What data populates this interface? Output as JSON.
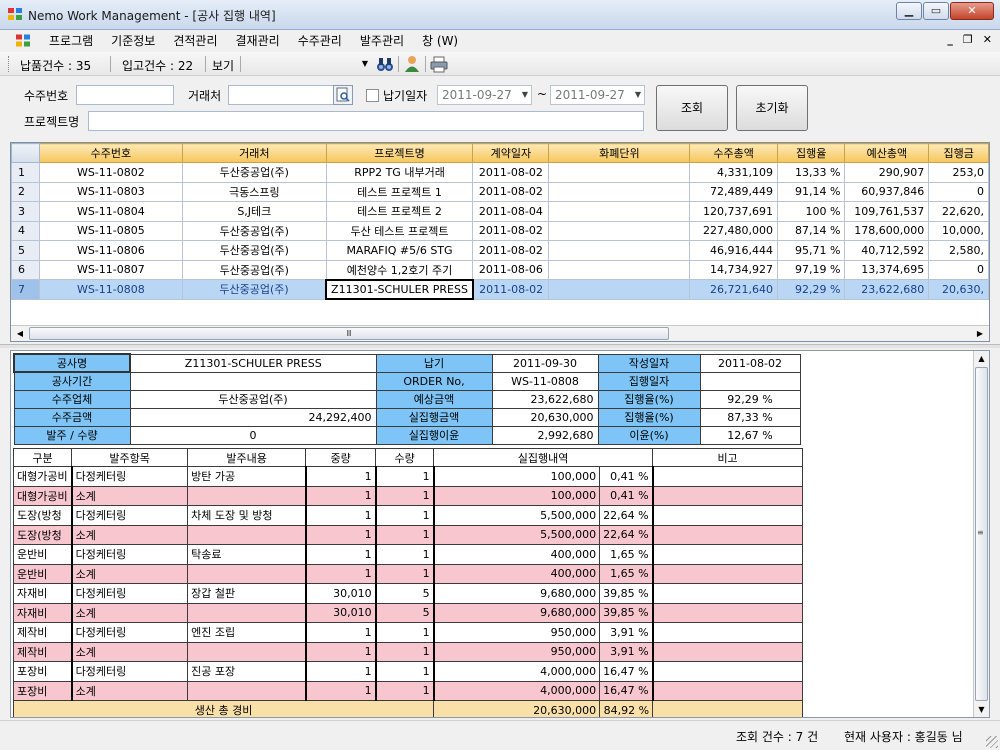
{
  "window": {
    "title": "Nemo Work Management - [공사 집행 내역]"
  },
  "menu": [
    "프로그램",
    "기준정보",
    "견적관리",
    "결재관리",
    "수주관리",
    "발주관리",
    "창 (W)"
  ],
  "toolbar": {
    "delivery": "납품건수 : 35",
    "receipt": "입고건수 : 22",
    "view": "보기"
  },
  "search": {
    "order_no_label": "수주번호",
    "client_label": "거래처",
    "due_label": "납기일자",
    "date_from": "2011-09-27",
    "tilde": "~",
    "date_to": "2011-09-27",
    "project_label": "프로젝트명",
    "search_button": "조회",
    "reset_button": "초기화"
  },
  "grid": {
    "columns": [
      "",
      "수주번호",
      "거래처",
      "프로젝트명",
      "계약일자",
      "화폐단위",
      "수주총액",
      "집행율",
      "예산총액",
      "집행금"
    ],
    "rows": [
      {
        "n": "1",
        "order": "WS-11-0802",
        "client": "두산중공업(주)",
        "project": "RPP2 TG 내부거래",
        "date": "2011-08-02",
        "currency": "",
        "total": "4,331,109",
        "rate": "13,33 %",
        "budget": "290,907",
        "exec": "253,0"
      },
      {
        "n": "2",
        "order": "WS-11-0803",
        "client": "극동스프링",
        "project": "테스트 프로젝트 1",
        "date": "2011-08-02",
        "currency": "",
        "total": "72,489,449",
        "rate": "91,14 %",
        "budget": "60,937,846",
        "exec": "0"
      },
      {
        "n": "3",
        "order": "WS-11-0804",
        "client": "S,J테크",
        "project": "테스트 프로젝트 2",
        "date": "2011-08-04",
        "currency": "",
        "total": "120,737,691",
        "rate": "100 %",
        "budget": "109,761,537",
        "exec": "22,620,"
      },
      {
        "n": "4",
        "order": "WS-11-0805",
        "client": "두산중공업(주)",
        "project": "두산 테스트 프로젝트",
        "date": "2011-08-02",
        "currency": "",
        "total": "227,480,000",
        "rate": "87,14 %",
        "budget": "178,600,000",
        "exec": "10,000,"
      },
      {
        "n": "5",
        "order": "WS-11-0806",
        "client": "두산중공업(주)",
        "project": "MARAFIQ #5/6 STG",
        "date": "2011-08-02",
        "currency": "",
        "total": "46,916,444",
        "rate": "95,71 %",
        "budget": "40,712,592",
        "exec": "2,580,"
      },
      {
        "n": "6",
        "order": "WS-11-0807",
        "client": "두산중공업(주)",
        "project": "예천양수 1,2호기 주기",
        "date": "2011-08-06",
        "currency": "",
        "total": "14,734,927",
        "rate": "97,19 %",
        "budget": "13,374,695",
        "exec": "0"
      },
      {
        "n": "7",
        "order": "WS-11-0808",
        "client": "두산중공업(주)",
        "project": "Z11301-SCHULER PRESS",
        "date": "2011-08-02",
        "currency": "",
        "total": "26,721,640",
        "rate": "92,29 %",
        "budget": "23,622,680",
        "exec": "20,630,"
      }
    ]
  },
  "info": {
    "k_name": "공사명",
    "v_name": "Z11301-SCHULER PRESS",
    "k_due": "납기",
    "v_due": "2011-09-30",
    "k_created": "작성일자",
    "v_created": "2011-08-02",
    "k_period": "공사기간",
    "v_period": "",
    "k_orderno": "ORDER No,",
    "v_orderno": "WS-11-0808",
    "k_execdate": "집행일자",
    "v_execdate": "",
    "k_client": "수주업체",
    "v_client": "두산중공업(주)",
    "k_expected": "예상금액",
    "v_expected": "23,622,680",
    "k_execrate": "집행율(%)",
    "v_execrate": "92,29 %",
    "k_amount": "수주금액",
    "v_amount": "24,292,400",
    "k_actual": "실집행금액",
    "v_actual": "20,630,000",
    "k_execrate2": "집행율(%)",
    "v_execrate2": "87,33 %",
    "k_poqty": "발주 / 수량",
    "v_poqty": "0",
    "k_profit": "실집행이윤",
    "v_profit": "2,992,680",
    "k_profitrate": "이윤(%)",
    "v_profitrate": "12,67 %"
  },
  "exec": {
    "headers": [
      "구분",
      "발주항목",
      "발주내용",
      "중량",
      "수량",
      "실집행내역",
      "비고"
    ],
    "rows": [
      {
        "cat": "대형가공비",
        "item": "다정케터링",
        "content": "방탄 가공",
        "weight": "1",
        "qty": "1",
        "amount": "100,000",
        "pct": "0,41 %",
        "sub": false
      },
      {
        "cat": "대형가공비",
        "item": "소계",
        "content": "",
        "weight": "1",
        "qty": "1",
        "amount": "100,000",
        "pct": "0,41 %",
        "sub": true
      },
      {
        "cat": "도장(방청",
        "item": "다정케터링",
        "content": "차체 도장 및 방청",
        "weight": "1",
        "qty": "1",
        "amount": "5,500,000",
        "pct": "22,64 %",
        "sub": false
      },
      {
        "cat": "도장(방청",
        "item": "소계",
        "content": "",
        "weight": "1",
        "qty": "1",
        "amount": "5,500,000",
        "pct": "22,64 %",
        "sub": true
      },
      {
        "cat": "운반비",
        "item": "다정케터링",
        "content": "탁송료",
        "weight": "1",
        "qty": "1",
        "amount": "400,000",
        "pct": "1,65 %",
        "sub": false
      },
      {
        "cat": "운반비",
        "item": "소계",
        "content": "",
        "weight": "1",
        "qty": "1",
        "amount": "400,000",
        "pct": "1,65 %",
        "sub": true
      },
      {
        "cat": "자재비",
        "item": "다정케터링",
        "content": "장갑 철판",
        "weight": "30,010",
        "qty": "5",
        "amount": "9,680,000",
        "pct": "39,85 %",
        "sub": false
      },
      {
        "cat": "자재비",
        "item": "소계",
        "content": "",
        "weight": "30,010",
        "qty": "5",
        "amount": "9,680,000",
        "pct": "39,85 %",
        "sub": true
      },
      {
        "cat": "제작비",
        "item": "다정케터링",
        "content": "엔진 조립",
        "weight": "1",
        "qty": "1",
        "amount": "950,000",
        "pct": "3,91 %",
        "sub": false
      },
      {
        "cat": "제작비",
        "item": "소계",
        "content": "",
        "weight": "1",
        "qty": "1",
        "amount": "950,000",
        "pct": "3,91 %",
        "sub": true
      },
      {
        "cat": "포장비",
        "item": "다정케터링",
        "content": "진공 포장",
        "weight": "1",
        "qty": "1",
        "amount": "4,000,000",
        "pct": "16,47 %",
        "sub": false
      },
      {
        "cat": "포장비",
        "item": "소계",
        "content": "",
        "weight": "1",
        "qty": "1",
        "amount": "4,000,000",
        "pct": "16,47 %",
        "sub": true
      }
    ],
    "total_label": "생산 총 경비",
    "total_amount": "20,630,000",
    "total_pct": "84,92 %"
  },
  "status": {
    "count": "조회 건수 : 7 건",
    "user": "현재 사용자 : 홍길동 님"
  }
}
